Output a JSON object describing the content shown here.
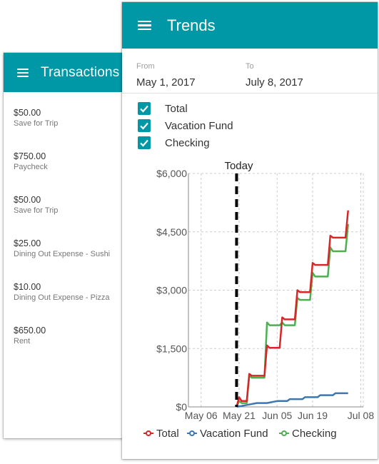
{
  "transactions_card": {
    "title": "Transactions",
    "items": [
      {
        "amount": "$50.00",
        "description": "Save for Trip"
      },
      {
        "amount": "$750.00",
        "description": "Paycheck"
      },
      {
        "amount": "$50.00",
        "description": "Save for Trip"
      },
      {
        "amount": "$25.00",
        "description": "Dining Out Expense - Sushi"
      },
      {
        "amount": "$10.00",
        "description": "Dining Out Expense - Pizza"
      },
      {
        "amount": "$650.00",
        "description": "Rent"
      }
    ]
  },
  "trends_card": {
    "title": "Trends",
    "from_label": "From",
    "from_value": "May 1, 2017",
    "to_label": "To",
    "to_value": "July 8, 2017",
    "checkboxes": [
      {
        "label": "Total",
        "checked": true
      },
      {
        "label": "Vacation Fund",
        "checked": true
      },
      {
        "label": "Checking",
        "checked": true
      }
    ]
  },
  "colors": {
    "app_bar": "#0097a7",
    "total": "#d62728",
    "vacation_fund": "#3a78b5",
    "checking": "#4caf50"
  },
  "chart_data": {
    "type": "line",
    "annotation": "Today",
    "today_x": "May 20",
    "x_ticks": [
      "May 06",
      "May 21",
      "Jun 05",
      "Jun 19",
      "Jul 08"
    ],
    "y_ticks": [
      "$0",
      "$1,500",
      "$3,000",
      "$4,500",
      "$6,000"
    ],
    "ylim": [
      0,
      6000
    ],
    "grid": true,
    "legend": "bottom",
    "series": [
      {
        "name": "Total",
        "color": "#d62728",
        "points": [
          [
            "May 20",
            0
          ],
          [
            "May 21",
            250
          ],
          [
            "May 22",
            150
          ],
          [
            "May 24",
            150
          ],
          [
            "May 25",
            850
          ],
          [
            "May 26",
            800
          ],
          [
            "May 31",
            800
          ],
          [
            "Jun 01",
            1580
          ],
          [
            "Jun 02",
            1520
          ],
          [
            "Jun 06",
            1520
          ],
          [
            "Jun 07",
            2300
          ],
          [
            "Jun 08",
            2250
          ],
          [
            "Jun 12",
            2250
          ],
          [
            "Jun 13",
            3000
          ],
          [
            "Jun 14",
            2950
          ],
          [
            "Jun 18",
            2950
          ],
          [
            "Jun 19",
            3700
          ],
          [
            "Jun 20",
            3650
          ],
          [
            "Jun 25",
            3650
          ],
          [
            "Jun 26",
            4400
          ],
          [
            "Jun 27",
            4350
          ],
          [
            "Jul 02",
            4350
          ],
          [
            "Jul 03",
            5050
          ]
        ]
      },
      {
        "name": "Vacation Fund",
        "color": "#3a78b5",
        "points": [
          [
            "May 20",
            0
          ],
          [
            "May 24",
            50
          ],
          [
            "May 28",
            100
          ],
          [
            "Jun 01",
            100
          ],
          [
            "Jun 05",
            150
          ],
          [
            "Jun 09",
            150
          ],
          [
            "Jun 10",
            200
          ],
          [
            "Jun 15",
            200
          ],
          [
            "Jun 16",
            250
          ],
          [
            "Jun 21",
            250
          ],
          [
            "Jun 22",
            300
          ],
          [
            "Jun 27",
            300
          ],
          [
            "Jun 28",
            350
          ],
          [
            "Jul 03",
            350
          ]
        ]
      },
      {
        "name": "Checking",
        "color": "#4caf50",
        "points": [
          [
            "May 20",
            0
          ],
          [
            "May 21",
            150
          ],
          [
            "May 22",
            100
          ],
          [
            "May 24",
            100
          ],
          [
            "May 25",
            800
          ],
          [
            "May 26",
            750
          ],
          [
            "May 31",
            750
          ],
          [
            "Jun 01",
            2170
          ],
          [
            "Jun 02",
            2100
          ],
          [
            "Jun 06",
            2100
          ],
          [
            "Jun 07",
            2170
          ],
          [
            "Jun 08",
            2100
          ],
          [
            "Jun 12",
            2100
          ],
          [
            "Jun 13",
            2800
          ],
          [
            "Jun 14",
            2750
          ],
          [
            "Jun 18",
            2750
          ],
          [
            "Jun 19",
            3450
          ],
          [
            "Jun 20",
            3350
          ],
          [
            "Jun 25",
            3350
          ],
          [
            "Jun 26",
            4100
          ],
          [
            "Jun 27",
            4000
          ],
          [
            "Jul 02",
            4000
          ],
          [
            "Jul 03",
            4700
          ]
        ]
      }
    ]
  }
}
